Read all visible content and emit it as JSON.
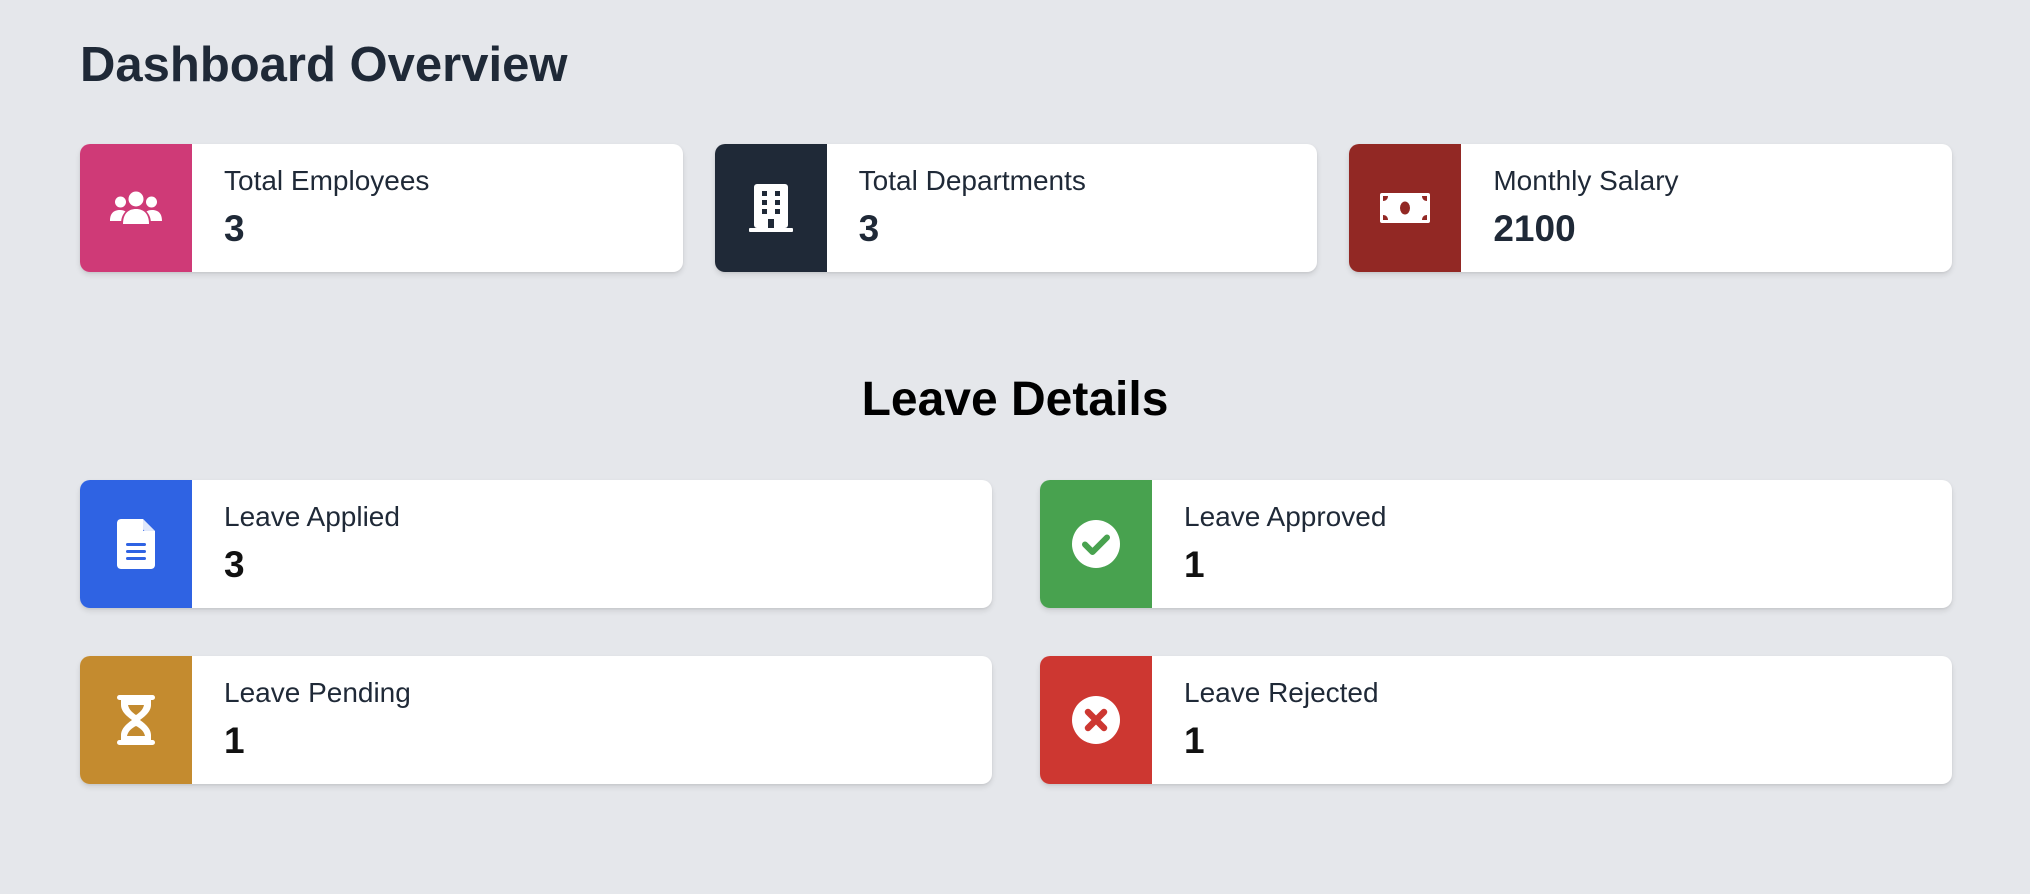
{
  "page": {
    "title": "Dashboard Overview"
  },
  "overview_cards": [
    {
      "label": "Total Employees",
      "value": "3",
      "icon": "users-icon",
      "color": "#cf3a77"
    },
    {
      "label": "Total Departments",
      "value": "3",
      "icon": "building-icon",
      "color": "#1f2937"
    },
    {
      "label": "Monthly Salary",
      "value": "2100",
      "icon": "money-bill-icon",
      "color": "#922824"
    }
  ],
  "leave_section": {
    "title": "Leave Details",
    "cards": [
      {
        "label": "Leave Applied",
        "value": "3",
        "icon": "file-text-icon",
        "color": "#2f63e3"
      },
      {
        "label": "Leave Approved",
        "value": "1",
        "icon": "check-circle-icon",
        "color": "#48a24f"
      },
      {
        "label": "Leave Pending",
        "value": "1",
        "icon": "hourglass-icon",
        "color": "#c48b2f"
      },
      {
        "label": "Leave Rejected",
        "value": "1",
        "icon": "times-circle-icon",
        "color": "#cd3731"
      }
    ]
  }
}
